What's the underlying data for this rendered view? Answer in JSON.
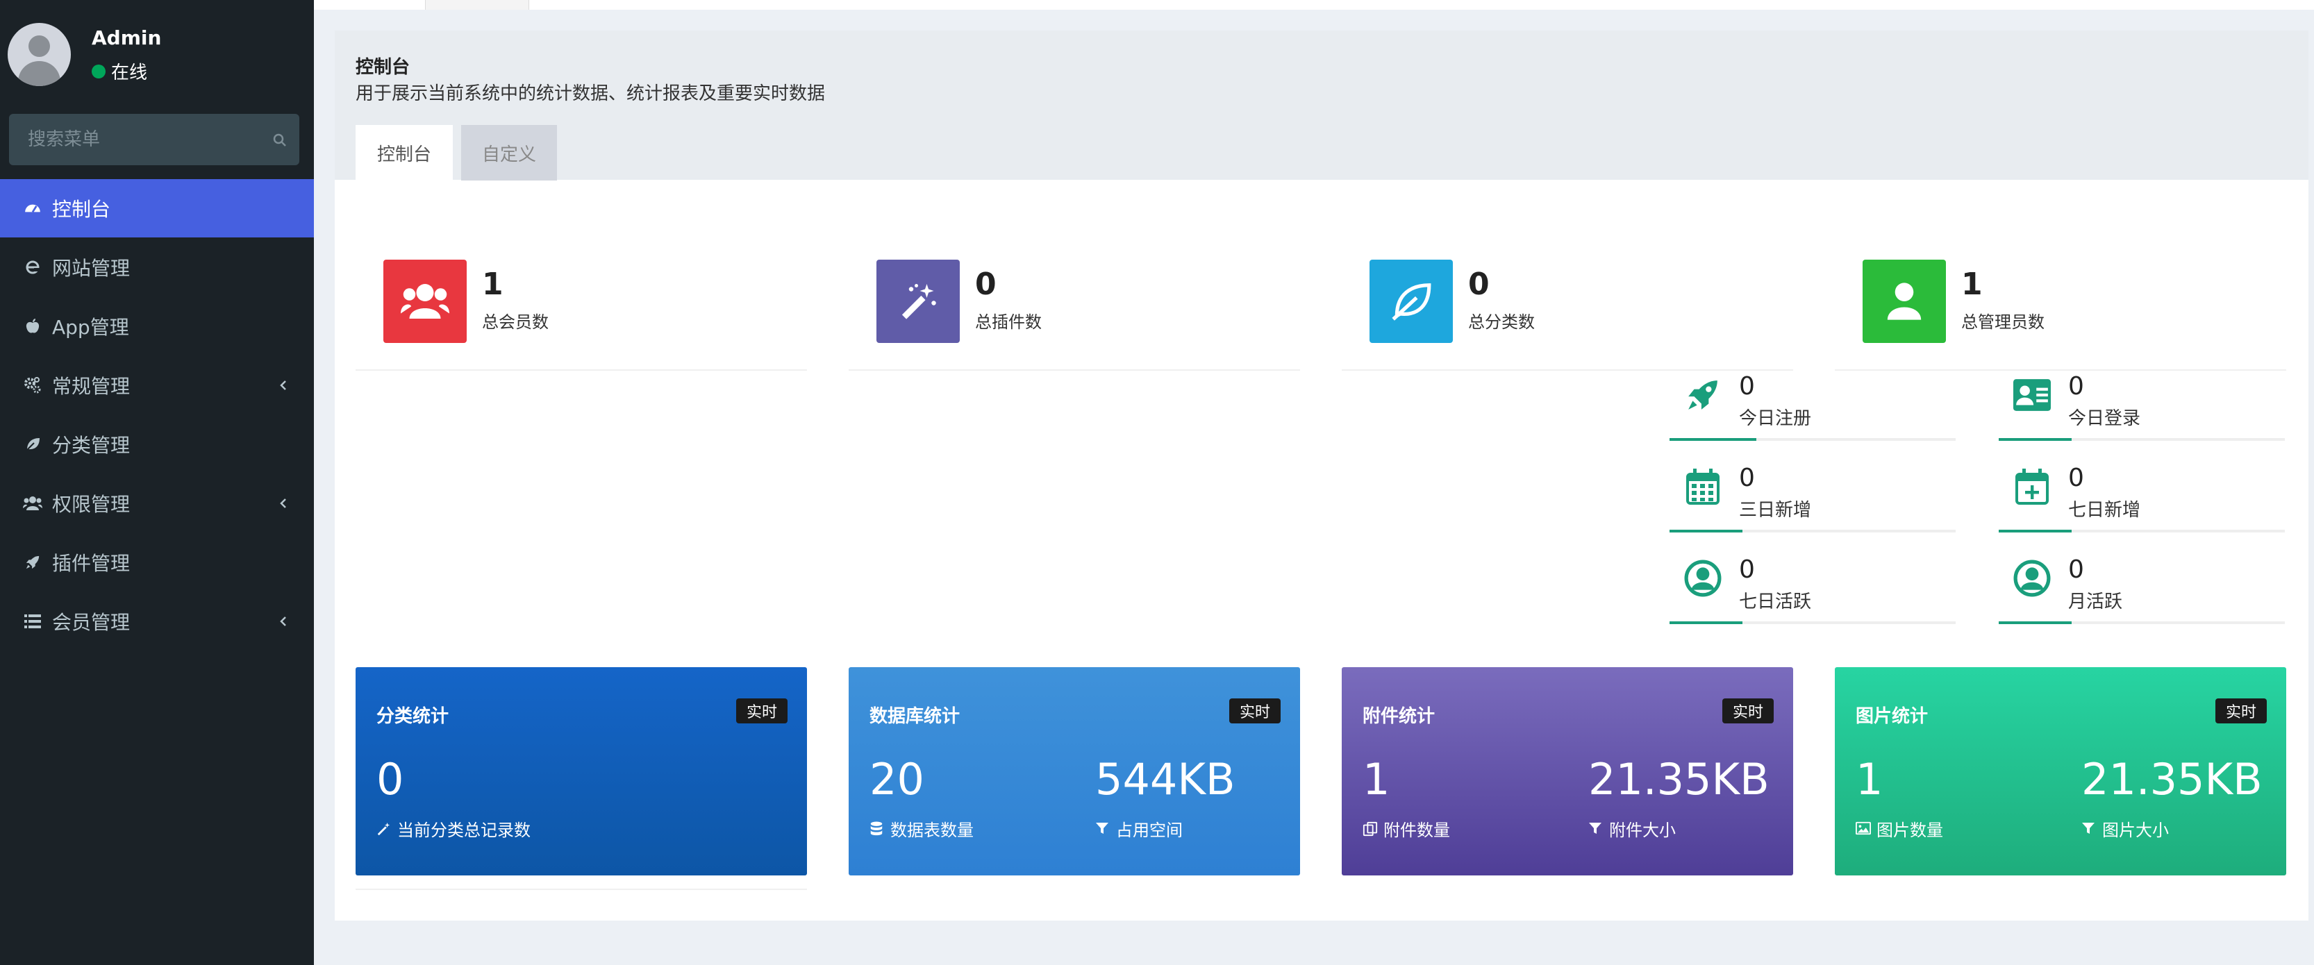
{
  "user": {
    "name": "Admin",
    "status": "在线"
  },
  "search": {
    "placeholder": "搜索菜单"
  },
  "menu": [
    {
      "label": "控制台",
      "icon": "dashboard-icon",
      "active": true
    },
    {
      "label": "网站管理",
      "icon": "ie-icon"
    },
    {
      "label": "App管理",
      "icon": "apple-icon"
    },
    {
      "label": "常规管理",
      "icon": "cogs-icon",
      "submenu": true
    },
    {
      "label": "分类管理",
      "icon": "leaf-icon"
    },
    {
      "label": "权限管理",
      "icon": "users-icon",
      "submenu": true
    },
    {
      "label": "插件管理",
      "icon": "rocket-icon"
    },
    {
      "label": "会员管理",
      "icon": "list-icon",
      "submenu": true
    }
  ],
  "panel": {
    "title": "控制台",
    "description": "用于展示当前系统中的统计数据、统计报表及重要实时数据",
    "tabs": [
      "控制台",
      "自定义"
    ]
  },
  "info_boxes": [
    {
      "value": "1",
      "label": "总会员数",
      "icon": "users-icon",
      "color": "#dd4b39"
    },
    {
      "value": "0",
      "label": "总插件数",
      "icon": "magic-icon",
      "color": "#605ca8"
    },
    {
      "value": "0",
      "label": "总分类数",
      "icon": "leaf-icon",
      "color": "#1ea7dd"
    },
    {
      "value": "1",
      "label": "总管理员数",
      "icon": "user-icon",
      "color": "#2bbb3a"
    }
  ],
  "stats": [
    {
      "value": "0",
      "label": "今日注册",
      "icon": "rocket-icon"
    },
    {
      "value": "0",
      "label": "今日登录",
      "icon": "vcard-icon"
    },
    {
      "value": "0",
      "label": "三日新增",
      "icon": "calendar-icon"
    },
    {
      "value": "0",
      "label": "七日新增",
      "icon": "calendar-plus-icon"
    },
    {
      "value": "0",
      "label": "七日活跃",
      "icon": "user-circle-icon"
    },
    {
      "value": "0",
      "label": "月活跃",
      "icon": "user-circle-icon"
    }
  ],
  "cards": [
    {
      "title": "分类统计",
      "badge": "实时",
      "num1": "0",
      "lbl1": "当前分类总记录数",
      "icon1": "magic-icon",
      "gradient": [
        "#1565c0",
        "#0d55a5"
      ]
    },
    {
      "title": "数据库统计",
      "badge": "实时",
      "num1": "20",
      "lbl1": "数据表数量",
      "icon1": "database-icon",
      "num2": "544KB",
      "lbl2": "占用空间",
      "icon2": "filter-icon",
      "gradient": [
        "#3b8fd8",
        "#2f80d4"
      ]
    },
    {
      "title": "附件统计",
      "badge": "实时",
      "num1": "1",
      "lbl1": "附件数量",
      "icon1": "files-icon",
      "num2": "21.35KB",
      "lbl2": "附件大小",
      "icon2": "filter-icon",
      "gradient": [
        "#7367b8",
        "#4e3f96"
      ]
    },
    {
      "title": "图片统计",
      "badge": "实时",
      "num1": "1",
      "lbl1": "图片数量",
      "icon1": "image-icon",
      "num2": "21.35KB",
      "lbl2": "图片大小",
      "icon2": "filter-icon",
      "gradient": [
        "#25d1a0",
        "#1fae7c"
      ]
    }
  ]
}
